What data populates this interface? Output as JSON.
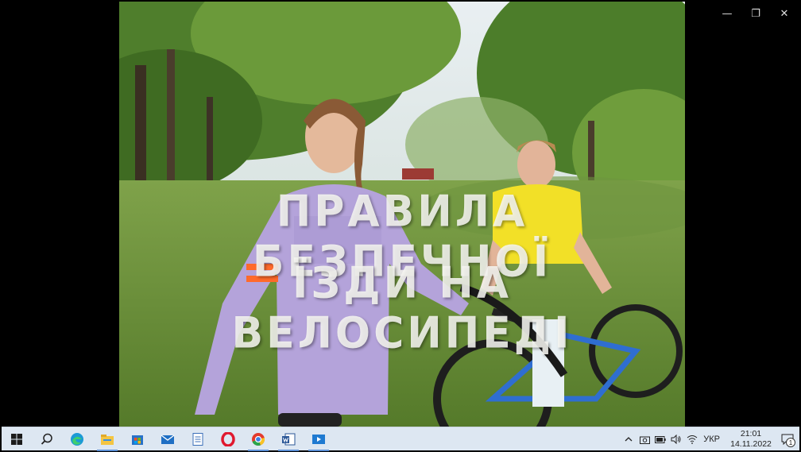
{
  "window": {
    "minimize_glyph": "—",
    "maximize_glyph": "❐",
    "close_glyph": "✕"
  },
  "video": {
    "title_line_1": "ПРАВИЛА БЕЗПЕЧНОЇ",
    "title_line_2": "ЇЗДИ НА ВЕЛОСИПЕДІ"
  },
  "taskbar": {
    "icons": [
      "windows-start-icon",
      "search-icon",
      "edge-browser-icon",
      "file-explorer-icon",
      "microsoft-store-icon",
      "mail-icon",
      "document-icon",
      "opera-browser-icon",
      "chrome-browser-icon",
      "word-icon",
      "media-player-icon"
    ],
    "tray": {
      "language": "УКР",
      "time": "21:01",
      "date": "14.11.2022",
      "notification_count": "1"
    }
  },
  "colors": {
    "taskbar_bg": "#dde7f2",
    "active_indicator": "#5b8fd6"
  }
}
